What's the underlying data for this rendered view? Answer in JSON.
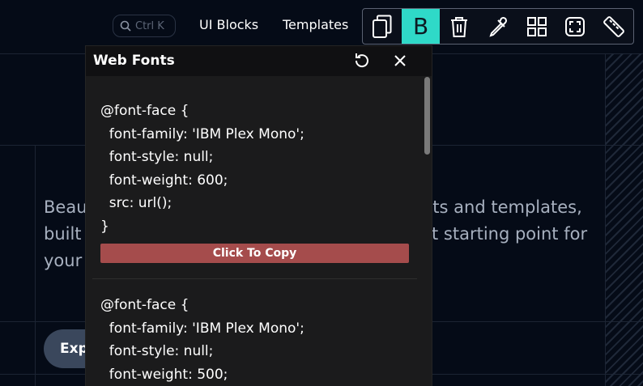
{
  "nav": {
    "search_placeholder": "Ctrl K",
    "links": [
      "UI Blocks",
      "Templates"
    ]
  },
  "toolbar": {
    "tools": [
      {
        "icon": "copy-icon"
      },
      {
        "icon": "bold-b-icon",
        "label": "B",
        "active": true
      },
      {
        "icon": "trash-icon"
      },
      {
        "icon": "eyedropper-icon"
      },
      {
        "icon": "grid-icon"
      },
      {
        "icon": "screenshot-frame-icon"
      },
      {
        "icon": "ruler-icon"
      }
    ],
    "accent_color": "#2fd9c8"
  },
  "hero": {
    "line1_left": "Beau",
    "line1_right": "nts and templates,",
    "line2_left": "built",
    "line2_right": "t starting point for",
    "line3_left": "your",
    "explore_label": "Expl"
  },
  "panel": {
    "title": "Web Fonts",
    "entries": [
      {
        "code": "@font-face {\n  font-family: 'IBM Plex Mono';\n  font-style: null;\n  font-weight: 600;\n  src: url();\n}",
        "copy_label": "Click To Copy"
      },
      {
        "code": "@font-face {\n  font-family: 'IBM Plex Mono';\n  font-style: null;\n  font-weight: 500;",
        "copy_label": ""
      }
    ],
    "copy_button_color": "#a54c4c"
  }
}
